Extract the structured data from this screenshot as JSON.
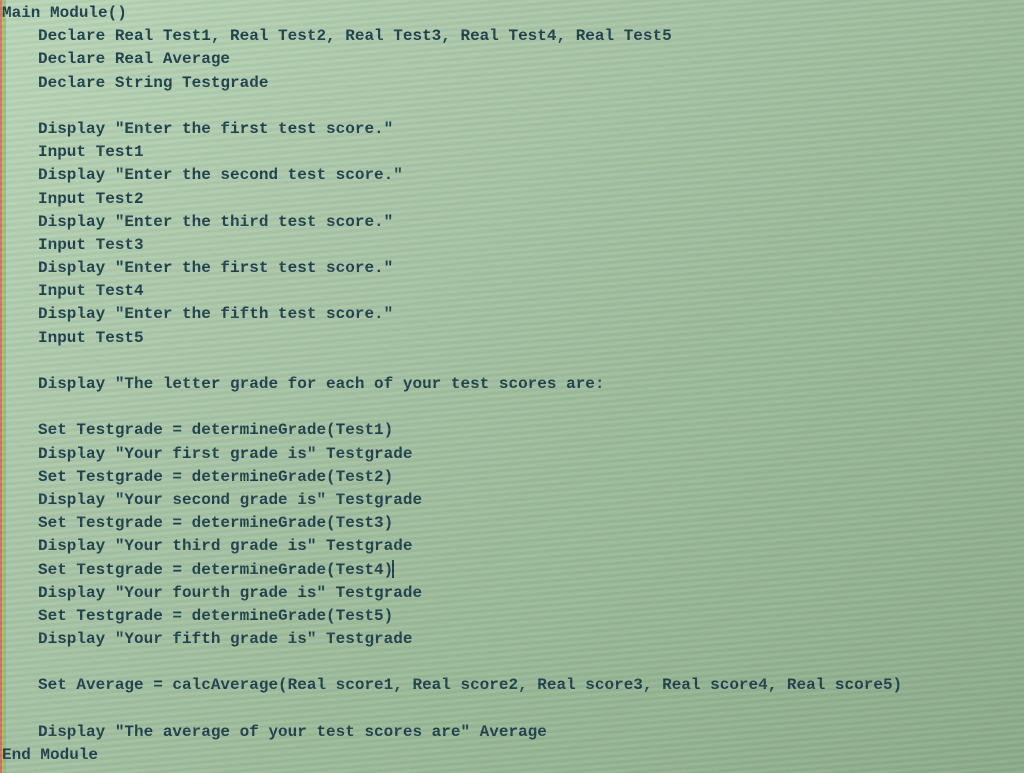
{
  "code": {
    "lines": [
      {
        "indent": 0,
        "text": "Main Module()"
      },
      {
        "indent": 1,
        "text": "Declare Real Test1, Real Test2, Real Test3, Real Test4, Real Test5"
      },
      {
        "indent": 1,
        "text": "Declare Real Average"
      },
      {
        "indent": 1,
        "text": "Declare String Testgrade"
      },
      {
        "indent": 1,
        "text": ""
      },
      {
        "indent": 1,
        "text": "Display \"Enter the first test score.\""
      },
      {
        "indent": 1,
        "text": "Input Test1"
      },
      {
        "indent": 1,
        "text": "Display \"Enter the second test score.\""
      },
      {
        "indent": 1,
        "text": "Input Test2"
      },
      {
        "indent": 1,
        "text": "Display \"Enter the third test score.\""
      },
      {
        "indent": 1,
        "text": "Input Test3"
      },
      {
        "indent": 1,
        "text": "Display \"Enter the first test score.\""
      },
      {
        "indent": 1,
        "text": "Input Test4"
      },
      {
        "indent": 1,
        "text": "Display \"Enter the fifth test score.\""
      },
      {
        "indent": 1,
        "text": "Input Test5"
      },
      {
        "indent": 1,
        "text": ""
      },
      {
        "indent": 1,
        "text": "Display \"The letter grade for each of your test scores are:"
      },
      {
        "indent": 1,
        "text": ""
      },
      {
        "indent": 1,
        "text": "Set Testgrade = determineGrade(Test1)"
      },
      {
        "indent": 1,
        "text": "Display \"Your first grade is\" Testgrade"
      },
      {
        "indent": 1,
        "text": "Set Testgrade = determineGrade(Test2)"
      },
      {
        "indent": 1,
        "text": "Display \"Your second grade is\" Testgrade"
      },
      {
        "indent": 1,
        "text": "Set Testgrade = determineGrade(Test3)"
      },
      {
        "indent": 1,
        "text": "Display \"Your third grade is\" Testgrade"
      },
      {
        "indent": 1,
        "text": "Set Testgrade = determineGrade(Test4)",
        "cursor": true
      },
      {
        "indent": 1,
        "text": "Display \"Your fourth grade is\" Testgrade"
      },
      {
        "indent": 1,
        "text": "Set Testgrade = determineGrade(Test5)"
      },
      {
        "indent": 1,
        "text": "Display \"Your fifth grade is\" Testgrade"
      },
      {
        "indent": 1,
        "text": ""
      },
      {
        "indent": 1,
        "text": "Set Average = calcAverage(Real score1, Real score2, Real score3, Real score4, Real score5)"
      },
      {
        "indent": 1,
        "text": ""
      },
      {
        "indent": 1,
        "text": "Display \"The average of your test scores are\" Average"
      },
      {
        "indent": 0,
        "text": "End Module"
      }
    ]
  }
}
